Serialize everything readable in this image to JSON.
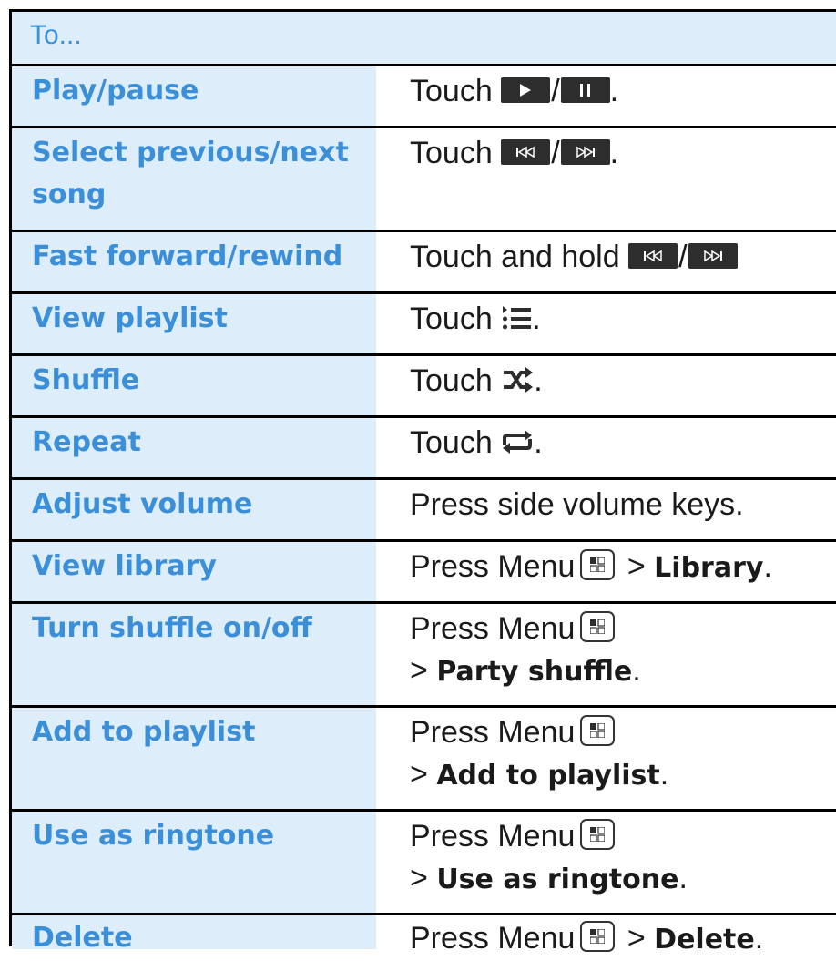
{
  "header": {
    "label": "To..."
  },
  "rows": [
    {
      "action": "Play/pause",
      "pre": "Touch",
      "post": "."
    },
    {
      "action": "Select previous/next song",
      "pre": "Touch",
      "post": "."
    },
    {
      "action": "Fast forward/rewind",
      "pre": "Touch and hold",
      "post": ""
    },
    {
      "action": "View playlist",
      "pre": "Touch",
      "post": "."
    },
    {
      "action": "Shuffle",
      "pre": "Touch",
      "post": "."
    },
    {
      "action": "Repeat",
      "pre": "Touch",
      "post": "."
    },
    {
      "action": "Adjust volume",
      "text": "Press side volume keys."
    },
    {
      "action": "View library",
      "pre": "Press Menu",
      "sep": ">",
      "bold": "Library",
      "post": "."
    },
    {
      "action": "Turn shuffle on/off",
      "pre": "Press Menu",
      "sep": ">",
      "bold": "Party shuffle",
      "post": "."
    },
    {
      "action": "Add to playlist",
      "pre": "Press Menu",
      "sep": ">",
      "bold": "Add to playlist",
      "post": "."
    },
    {
      "action": "Use as ringtone",
      "pre": "Press Menu",
      "sep": ">",
      "bold": "Use as ringtone",
      "post": "."
    },
    {
      "action": "Delete",
      "pre": "Press Menu",
      "sep": ">",
      "bold": "Delete",
      "post": "."
    }
  ],
  "icons": {
    "play": "play-icon",
    "pause": "pause-icon",
    "previous": "previous-icon",
    "next": "next-icon",
    "playlist": "playlist-icon",
    "shuffle": "shuffle-icon",
    "repeat": "repeat-icon",
    "menu": "menu-key-icon"
  },
  "colors": {
    "accent": "#3b8fd9",
    "action_bg": "#ddeefa",
    "text": "#1a1a1a",
    "button": "#2d2d2d"
  },
  "slash": "/"
}
